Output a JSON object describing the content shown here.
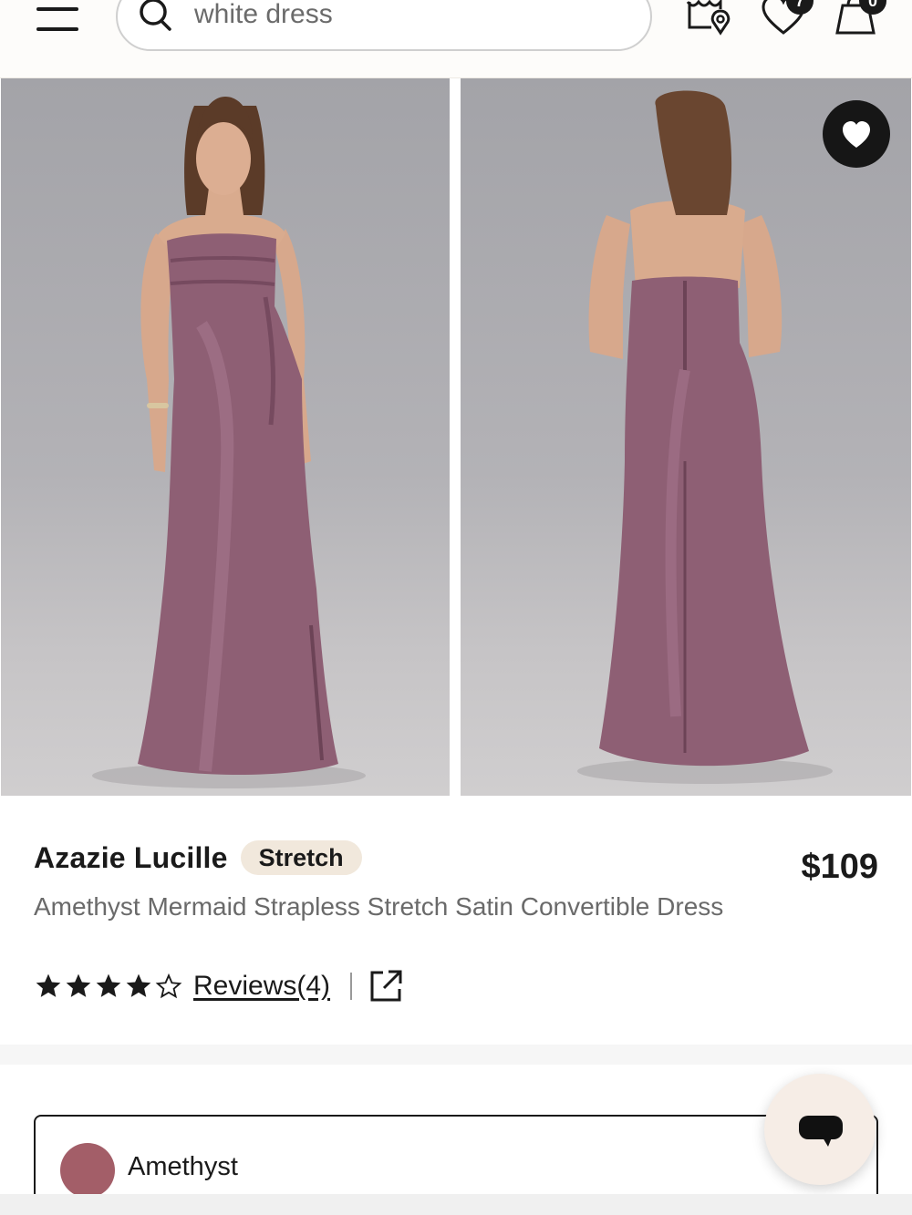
{
  "header": {
    "menu_icon": "hamburger-menu-icon",
    "search": {
      "value": "",
      "placeholder": "white dress",
      "icon": "search-icon"
    },
    "store_locator_icon": "store-location-icon",
    "wishlist": {
      "icon": "heart-icon",
      "count": "7"
    },
    "cart": {
      "icon": "shopping-bag-icon",
      "count": "0"
    }
  },
  "gallery": {
    "images": [
      {
        "view": "front",
        "dress_color": "#8e5f74"
      },
      {
        "view": "back",
        "dress_color": "#8e5f74"
      }
    ],
    "wishlist_button_icon": "heart-icon"
  },
  "product": {
    "brand": "Azazie Lucille",
    "tag": "Stretch",
    "price": "$109",
    "name": "Amethyst Mermaid Strapless Stretch Satin Convertible Dress",
    "rating": {
      "value": 4,
      "max": 5
    },
    "reviews_label": "Reviews(4)",
    "share_icon": "external-link-icon"
  },
  "color_selector": {
    "selected_name": "Amethyst",
    "selected_swatch": "#a35e68"
  },
  "chat": {
    "icon": "chat-bubble-icon"
  },
  "colors": {
    "text_primary": "#1a1a1a",
    "text_secondary": "#6a6a6a",
    "tag_bg": "#f1e8dc",
    "photo_bg": "#b1b0b5"
  }
}
